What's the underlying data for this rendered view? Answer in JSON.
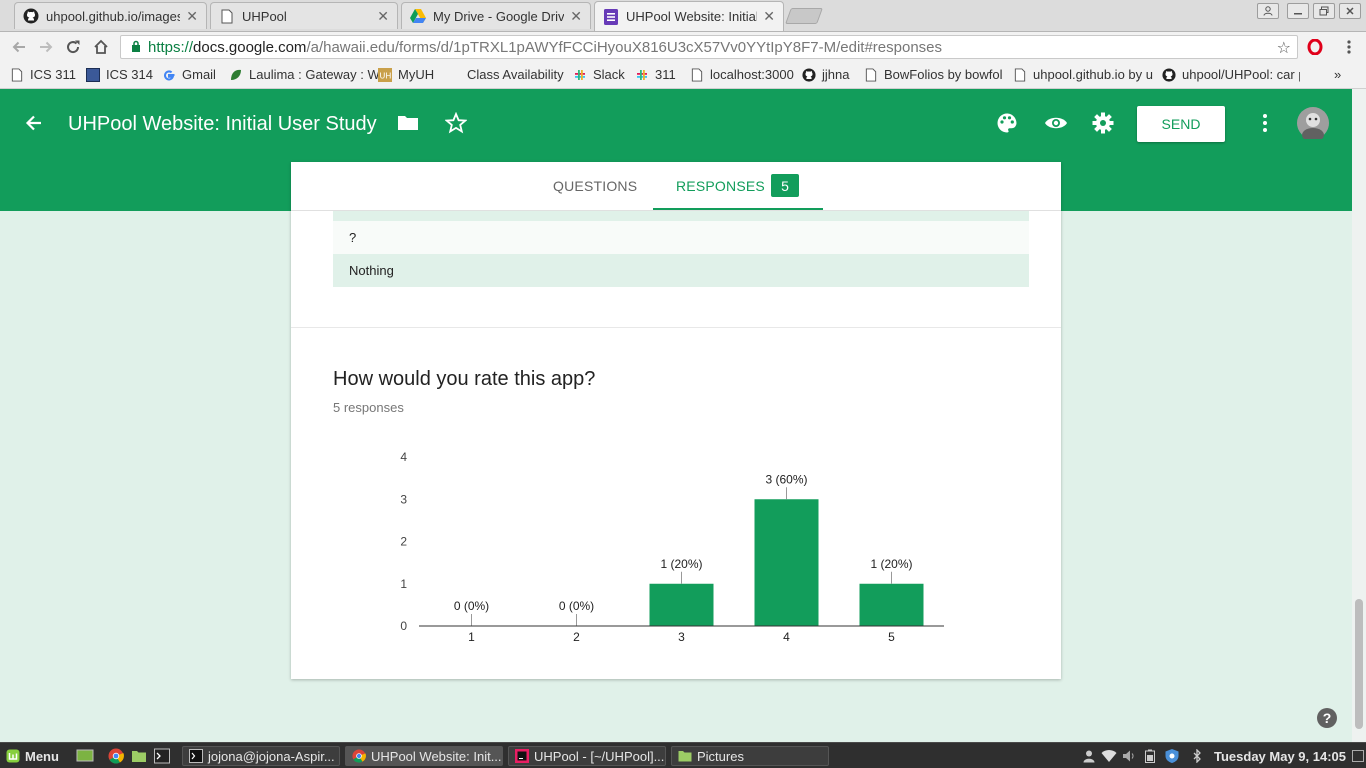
{
  "browser": {
    "tabs": [
      {
        "label": "uhpool.github.io/images",
        "icon": "github-icon"
      },
      {
        "label": "UHPool",
        "icon": "page-icon"
      },
      {
        "label": "My Drive - Google Drive",
        "icon": "google-drive-icon"
      },
      {
        "label": "UHPool Website: Initial",
        "icon": "google-forms-icon"
      }
    ],
    "url": {
      "scheme": "https://",
      "host": "docs.google.com",
      "path": "/a/hawaii.edu/forms/d/1pTRXL1pAWYfFCCiHyouX816U3cX57Vv0YYtIpY8F7-M/edit#responses"
    },
    "bookmarks": [
      {
        "label": "ICS 311",
        "icon": "page-icon"
      },
      {
        "label": "ICS 314",
        "icon": "square-icon"
      },
      {
        "label": "Gmail",
        "icon": "google-icon"
      },
      {
        "label": "Laulima : Gateway : W",
        "icon": "leaf-icon"
      },
      {
        "label": "MyUH",
        "icon": "uh-icon"
      },
      {
        "label": "Class Availability",
        "icon": "none"
      },
      {
        "label": "Slack",
        "icon": "slack-icon"
      },
      {
        "label": "311",
        "icon": "slack-icon"
      },
      {
        "label": "localhost:3000",
        "icon": "page-icon"
      },
      {
        "label": "jjhna",
        "icon": "github-icon"
      },
      {
        "label": "BowFolios by bowfoli",
        "icon": "page-icon"
      },
      {
        "label": "uhpool.github.io by u",
        "icon": "page-icon"
      },
      {
        "label": "uhpool/UHPool: car p",
        "icon": "github-icon"
      }
    ],
    "bookmarks_overflow": "»"
  },
  "forms": {
    "title": "UHPool Website: Initial User Study",
    "send_label": "SEND",
    "tabs": {
      "questions": "QUESTIONS",
      "responses": "RESPONSES",
      "responses_count": "5"
    },
    "text_responses": [
      "?",
      "Nothing"
    ],
    "question": {
      "title": "How would you rate this app?",
      "subtitle": "5 responses"
    },
    "accent_color": "#129d5b"
  },
  "chart_data": {
    "type": "bar",
    "categories": [
      "1",
      "2",
      "3",
      "4",
      "5"
    ],
    "values": [
      0,
      0,
      1,
      3,
      1
    ],
    "data_labels": [
      "0 (0%)",
      "0 (0%)",
      "1 (20%)",
      "3 (60%)",
      "1 (20%)"
    ],
    "y_ticks": [
      "0",
      "1",
      "2",
      "3",
      "4"
    ],
    "ylim": [
      0,
      4
    ],
    "title": "",
    "xlabel": "",
    "ylabel": "",
    "bar_color": "#129d5b",
    "grid": false
  },
  "taskbar": {
    "menu_label": "Menu",
    "windows": [
      {
        "label": "jojona@jojona-Aspir...",
        "icon": "terminal-icon"
      },
      {
        "label": "UHPool Website: Init...",
        "icon": "chrome-icon"
      },
      {
        "label": "UHPool - [~/UHPool]...",
        "icon": "intellij-icon"
      },
      {
        "label": "Pictures",
        "icon": "folder-icon"
      }
    ],
    "clock": "Tuesday May  9, 14:05"
  }
}
